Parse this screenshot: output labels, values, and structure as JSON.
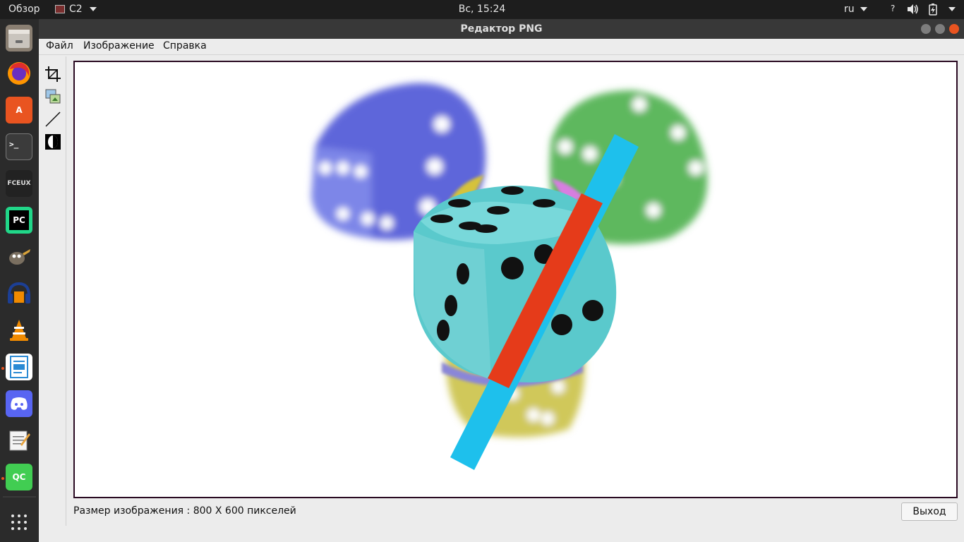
{
  "topbar": {
    "overview": "Обзор",
    "app_name": "C2",
    "clock": "Вс, 15:24",
    "language": "ru",
    "help_icon": "?",
    "volume_icon": "volume-icon",
    "battery_icon": "battery-icon",
    "system_menu_icon": "system-menu-icon"
  },
  "dock": {
    "items": [
      {
        "name": "files",
        "icon": "files-icon",
        "color": "#8a7f72"
      },
      {
        "name": "firefox",
        "icon": "firefox-icon",
        "color": "#e66000"
      },
      {
        "name": "software",
        "icon": "software-center-icon",
        "color": "#e95420",
        "glyph": "A"
      },
      {
        "name": "terminal",
        "icon": "terminal-icon",
        "color": "#3b3b3b",
        "glyph": ">_"
      },
      {
        "name": "fceux",
        "icon": "fceux-icon",
        "color": "#222222",
        "glyph": "FCEUX"
      },
      {
        "name": "pycharm",
        "icon": "pycharm-icon",
        "color": "#21d789",
        "glyph": "PC"
      },
      {
        "name": "gimp",
        "icon": "gimp-icon",
        "color": "#5a5a5a"
      },
      {
        "name": "audacity",
        "icon": "audacity-icon",
        "color": "#1c3f95"
      },
      {
        "name": "vlc",
        "icon": "vlc-icon",
        "color": "#f08a00"
      },
      {
        "name": "writer",
        "icon": "writer-icon",
        "color": "#2a8ad4"
      },
      {
        "name": "discord",
        "icon": "discord-icon",
        "color": "#5865f2"
      },
      {
        "name": "text-editor",
        "icon": "text-editor-icon",
        "color": "#f4f4f4"
      },
      {
        "name": "qtcreator",
        "icon": "qtcreator-icon",
        "color": "#41cd52",
        "glyph": "QC"
      }
    ],
    "show_apps_icon": "apps-grid-icon"
  },
  "window": {
    "title": "Редактор PNG"
  },
  "menubar": {
    "file": "Файл",
    "image": "Изображение",
    "help": "Справка"
  },
  "toolbar": {
    "tools": [
      {
        "name": "crop-tool",
        "icon": "crop-icon"
      },
      {
        "name": "layers-tool",
        "icon": "image-layers-icon"
      },
      {
        "name": "line-tool",
        "icon": "line-icon"
      },
      {
        "name": "invert-tool",
        "icon": "invert-icon"
      }
    ]
  },
  "status": {
    "size_text": "Размер изображения : 800 X 600 пикселей"
  },
  "exit_button": "Выход"
}
